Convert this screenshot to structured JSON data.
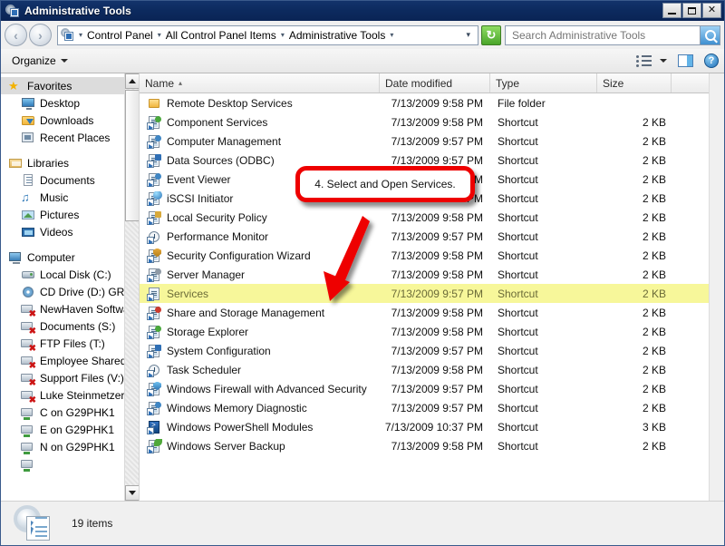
{
  "window": {
    "title": "Administrative Tools",
    "icon": "admin-tools-icon",
    "minimize_label": "",
    "maximize_label": "",
    "close_label": "✕"
  },
  "address_bar": {
    "back_label": "‹",
    "forward_label": "›",
    "crumbs": [
      "Control Panel",
      "All Control Panel Items",
      "Administrative Tools"
    ],
    "refresh_label": "↻",
    "dropdown_label": "▾"
  },
  "search": {
    "placeholder": "Search Administrative Tools",
    "value": ""
  },
  "command_bar": {
    "organize_label": "Organize",
    "view_icon": "list-view-icon",
    "view_dropdown": "▾",
    "preview_pane_icon": "preview-pane-icon",
    "help_label": "?"
  },
  "sidebar": {
    "groups": [
      {
        "root": {
          "label": "Favorites",
          "icon": "star-icon",
          "selected": true
        },
        "items": [
          {
            "label": "Desktop",
            "icon": "desktop-icon"
          },
          {
            "label": "Downloads",
            "icon": "downloads-folder-icon"
          },
          {
            "label": "Recent Places",
            "icon": "recent-places-icon"
          }
        ]
      },
      {
        "root": {
          "label": "Libraries",
          "icon": "libraries-icon",
          "selected": false
        },
        "items": [
          {
            "label": "Documents",
            "icon": "documents-library-icon"
          },
          {
            "label": "Music",
            "icon": "music-library-icon"
          },
          {
            "label": "Pictures",
            "icon": "pictures-library-icon"
          },
          {
            "label": "Videos",
            "icon": "videos-library-icon"
          }
        ]
      },
      {
        "root": {
          "label": "Computer",
          "icon": "computer-icon",
          "selected": false
        },
        "items": [
          {
            "label": "Local Disk (C:)",
            "icon": "hard-disk-icon"
          },
          {
            "label": "CD Drive (D:) GRM",
            "icon": "cd-drive-icon"
          },
          {
            "label": "NewHaven Softwar",
            "icon": "disconnected-network-drive-icon"
          },
          {
            "label": "Documents (S:)",
            "icon": "disconnected-network-drive-icon"
          },
          {
            "label": "FTP Files (T:)",
            "icon": "disconnected-network-drive-icon"
          },
          {
            "label": "Employee Shared F",
            "icon": "disconnected-network-drive-icon"
          },
          {
            "label": "Support Files (V:)",
            "icon": "disconnected-network-drive-icon"
          },
          {
            "label": "Luke Steinmetzer's",
            "icon": "disconnected-network-drive-icon"
          },
          {
            "label": "C on G29PHK1",
            "icon": "network-drive-icon"
          },
          {
            "label": "E on G29PHK1",
            "icon": "network-drive-icon"
          },
          {
            "label": "N on G29PHK1",
            "icon": "network-drive-icon"
          }
        ]
      }
    ],
    "scrollbar": {
      "up_arrow": "▲",
      "down_arrow": "▼"
    }
  },
  "file_list": {
    "columns": [
      {
        "label": "Name",
        "sorted": true,
        "sort_arrow": "▴"
      },
      {
        "label": "Date modified",
        "sorted": false,
        "sort_arrow": ""
      },
      {
        "label": "Type",
        "sorted": false,
        "sort_arrow": ""
      },
      {
        "label": "Size",
        "sorted": false,
        "sort_arrow": ""
      }
    ],
    "rows": [
      {
        "name": "Remote Desktop Services",
        "date": "7/13/2009 9:58 PM",
        "type": "File folder",
        "size": "",
        "icon": "folder-icon",
        "highlighted": false
      },
      {
        "name": "Component Services",
        "date": "7/13/2009 9:58 PM",
        "type": "Shortcut",
        "size": "2 KB",
        "icon": "component-services-icon",
        "highlighted": false
      },
      {
        "name": "Computer Management",
        "date": "7/13/2009 9:57 PM",
        "type": "Shortcut",
        "size": "2 KB",
        "icon": "computer-management-icon",
        "highlighted": false
      },
      {
        "name": "Data Sources (ODBC)",
        "date": "7/13/2009 9:57 PM",
        "type": "Shortcut",
        "size": "2 KB",
        "icon": "data-sources-icon",
        "highlighted": false
      },
      {
        "name": "Event Viewer",
        "date": "7/13/2009 9:58 PM",
        "type": "Shortcut",
        "size": "2 KB",
        "icon": "event-viewer-icon",
        "highlighted": false
      },
      {
        "name": "iSCSI Initiator",
        "date": "7/13/2009 9:57 PM",
        "type": "Shortcut",
        "size": "2 KB",
        "icon": "iscsi-initiator-icon",
        "highlighted": false
      },
      {
        "name": "Local Security Policy",
        "date": "7/13/2009 9:58 PM",
        "type": "Shortcut",
        "size": "2 KB",
        "icon": "local-security-policy-icon",
        "highlighted": false
      },
      {
        "name": "Performance Monitor",
        "date": "7/13/2009 9:57 PM",
        "type": "Shortcut",
        "size": "2 KB",
        "icon": "performance-monitor-icon",
        "highlighted": false
      },
      {
        "name": "Security Configuration Wizard",
        "date": "7/13/2009 9:58 PM",
        "type": "Shortcut",
        "size": "2 KB",
        "icon": "security-configuration-wizard-icon",
        "highlighted": false
      },
      {
        "name": "Server Manager",
        "date": "7/13/2009 9:58 PM",
        "type": "Shortcut",
        "size": "2 KB",
        "icon": "server-manager-icon",
        "highlighted": false
      },
      {
        "name": "Services",
        "date": "7/13/2009 9:57 PM",
        "type": "Shortcut",
        "size": "2 KB",
        "icon": "services-icon",
        "highlighted": true
      },
      {
        "name": "Share and Storage Management",
        "date": "7/13/2009 9:58 PM",
        "type": "Shortcut",
        "size": "2 KB",
        "icon": "share-storage-icon",
        "highlighted": false
      },
      {
        "name": "Storage Explorer",
        "date": "7/13/2009 9:58 PM",
        "type": "Shortcut",
        "size": "2 KB",
        "icon": "storage-explorer-icon",
        "highlighted": false
      },
      {
        "name": "System Configuration",
        "date": "7/13/2009 9:57 PM",
        "type": "Shortcut",
        "size": "2 KB",
        "icon": "system-configuration-icon",
        "highlighted": false
      },
      {
        "name": "Task Scheduler",
        "date": "7/13/2009 9:58 PM",
        "type": "Shortcut",
        "size": "2 KB",
        "icon": "task-scheduler-icon",
        "highlighted": false
      },
      {
        "name": "Windows Firewall with Advanced Security",
        "date": "7/13/2009 9:57 PM",
        "type": "Shortcut",
        "size": "2 KB",
        "icon": "windows-firewall-icon",
        "highlighted": false
      },
      {
        "name": "Windows Memory Diagnostic",
        "date": "7/13/2009 9:57 PM",
        "type": "Shortcut",
        "size": "2 KB",
        "icon": "memory-diagnostic-icon",
        "highlighted": false
      },
      {
        "name": "Windows PowerShell Modules",
        "date": "7/13/2009 10:37 PM",
        "type": "Shortcut",
        "size": "3 KB",
        "icon": "powershell-icon",
        "highlighted": false
      },
      {
        "name": "Windows Server Backup",
        "date": "7/13/2009 9:58 PM",
        "type": "Shortcut",
        "size": "2 KB",
        "icon": "server-backup-icon",
        "highlighted": false
      }
    ]
  },
  "annotation": {
    "callout_text": "4. Select and Open Services.",
    "callout_color": "#ee0000",
    "arrow_color": "#ee0000"
  },
  "status_bar": {
    "item_count": "19 items",
    "icon": "admin-tools-large-icon"
  },
  "colors": {
    "titlebar": "#0c2a5e",
    "highlight_row": "#f7f79a",
    "accent_red": "#ee0000",
    "chrome": "#f0f0f0"
  }
}
